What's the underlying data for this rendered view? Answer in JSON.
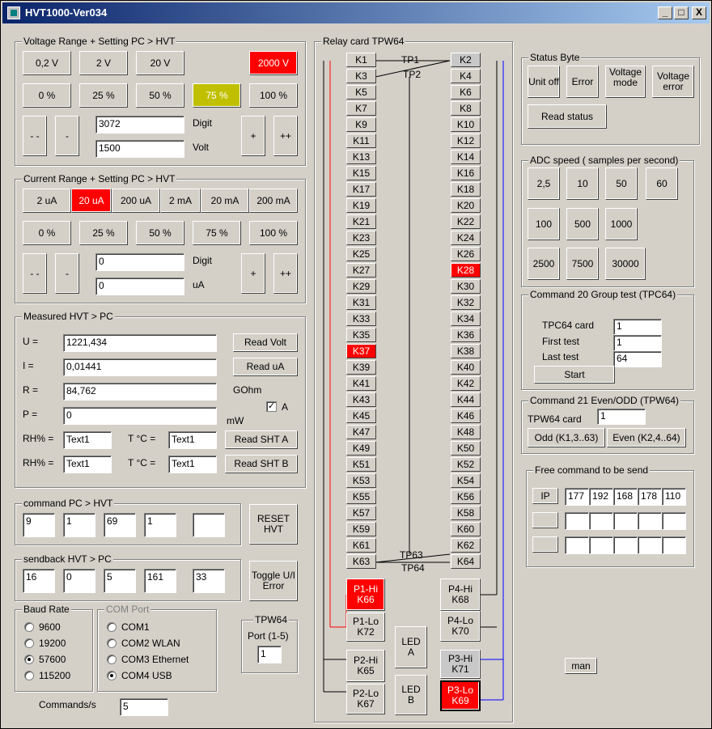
{
  "title": "HVT1000-Ver034",
  "wbtns": [
    "_",
    "□",
    "X"
  ],
  "vr": {
    "legend": "Voltage Range + Setting  PC > HVT",
    "ranges": [
      "0,2 V",
      "2 V",
      "20 V",
      "2000 V"
    ],
    "pcts": [
      "0 %",
      "25 %",
      "50 %",
      "75 %",
      "100 %"
    ],
    "digit": "3072",
    "volt": "1500",
    "digit_label": "Digit",
    "volt_label": "Volt"
  },
  "cr": {
    "legend": "Current Range + Setting  PC > HVT",
    "ranges": [
      "2 uA",
      "20 uA",
      "200 uA",
      "2 mA",
      "20 mA",
      "200 mA"
    ],
    "pcts": [
      "0 %",
      "25 %",
      "50 %",
      "75 %",
      "100 %"
    ],
    "digit": "0",
    "ua": "0",
    "digit_label": "Digit",
    "ua_label": "uA"
  },
  "steps": {
    "mm": "- -",
    "m": "-",
    "p": "+",
    "pp": "++"
  },
  "meas": {
    "legend": "Measured  HVT > PC",
    "u_label": "U =",
    "i_label": "I =",
    "r_label": "R =",
    "p_label": "P =",
    "u": "1221,434",
    "i": "0,01441",
    "r": "84,762",
    "p": "0",
    "read_volt": "Read Volt",
    "read_ua": "Read uA",
    "gohm": "GOhm",
    "mw": "mW",
    "chk_a": "A",
    "rh_label": "RH% =",
    "t_label": "T °C =",
    "rh_a": "Text1",
    "t_a": "Text1",
    "rh_b": "Text1",
    "t_b": "Text1",
    "read_sht_a": "Read SHT A",
    "read_sht_b": "Read SHT B"
  },
  "cmd": {
    "legend": "command PC > HVT",
    "values": [
      "9",
      "1",
      "69",
      "1",
      ""
    ],
    "reset": "RESET HVT"
  },
  "sb": {
    "legend": "sendback  HVT > PC",
    "values": [
      "16",
      "0",
      "5",
      "161",
      "33"
    ],
    "toggle": "Toggle U/I Error"
  },
  "baud": {
    "legend": "Baud Rate",
    "items": [
      "9600",
      "19200",
      "57600",
      "115200"
    ]
  },
  "com": {
    "legend": "COM Port",
    "items": [
      "COM1",
      "COM2 WLAN",
      "COM3 Ethernet",
      "COM4 USB"
    ]
  },
  "tpw": {
    "legend": "TPW64",
    "port_label": "Port (1-5)",
    "port": "1"
  },
  "cps": {
    "label": "Commands/s",
    "value": "5"
  },
  "relay": {
    "legend": "Relay card TPW64",
    "left": [
      "K1",
      "K3",
      "K5",
      "K7",
      "K9",
      "K11",
      "K13",
      "K15",
      "K17",
      "K19",
      "K21",
      "K23",
      "K25",
      "K27",
      "K29",
      "K31",
      "K33",
      "K35",
      "K37",
      "K39",
      "K41",
      "K43",
      "K45",
      "K47",
      "K49",
      "K51",
      "K53",
      "K55",
      "K57",
      "K59",
      "K61",
      "K63"
    ],
    "right": [
      "K2",
      "K4",
      "K6",
      "K8",
      "K10",
      "K12",
      "K14",
      "K16",
      "K18",
      "K20",
      "K22",
      "K24",
      "K26",
      "K28",
      "K30",
      "K32",
      "K34",
      "K36",
      "K38",
      "K40",
      "K42",
      "K44",
      "K46",
      "K48",
      "K50",
      "K52",
      "K54",
      "K56",
      "K58",
      "K60",
      "K62",
      "K64"
    ],
    "tp1": "TP1",
    "tp2": "TP2",
    "tp63": "TP63",
    "tp64": "TP64",
    "p1hi": [
      "P1-Hi",
      "K66"
    ],
    "p1lo": [
      "P1-Lo",
      "K72"
    ],
    "p2hi": [
      "P2-Hi",
      "K65"
    ],
    "p2lo": [
      "P2-Lo",
      "K67"
    ],
    "p4hi": [
      "P4-Hi",
      "K68"
    ],
    "p4lo": [
      "P4-Lo",
      "K70"
    ],
    "p3hi": [
      "P3-Hi",
      "K71"
    ],
    "p3lo": [
      "P3-Lo",
      "K69"
    ],
    "leda": [
      "LED",
      "A"
    ],
    "ledb": [
      "LED",
      "B"
    ]
  },
  "status": {
    "legend": "Status Byte",
    "b1": "Unit off",
    "b2": "Error",
    "b3": "Voltage mode",
    "b4": "Voltage error",
    "read": "Read status"
  },
  "adc": {
    "legend": "ADC speed ( samples per second)",
    "vals": [
      "2,5",
      "10",
      "50",
      "60",
      "100",
      "500",
      "1000",
      "2500",
      "7500",
      "30000"
    ]
  },
  "g20": {
    "legend": "Command 20 Group test (TPC64)",
    "l1": "TPC64 card",
    "l2": "First test",
    "l3": "Last test",
    "v1": "1",
    "v2": "1",
    "v3": "64",
    "start": "Start"
  },
  "g21": {
    "legend": "Command 21 Even/ODD (TPW64)",
    "l1": "TPW64 card",
    "v1": "1",
    "odd": "Odd (K1,3..63)",
    "even": "Even (K2,4..64)"
  },
  "free": {
    "legend": "Free command to be send",
    "ip": "IP",
    "row1": [
      "177",
      "192",
      "168",
      "178",
      "110"
    ],
    "row2": [
      "",
      "",
      "",
      "",
      ""
    ],
    "row3": [
      "",
      "",
      "",
      "",
      ""
    ]
  },
  "man": "man"
}
